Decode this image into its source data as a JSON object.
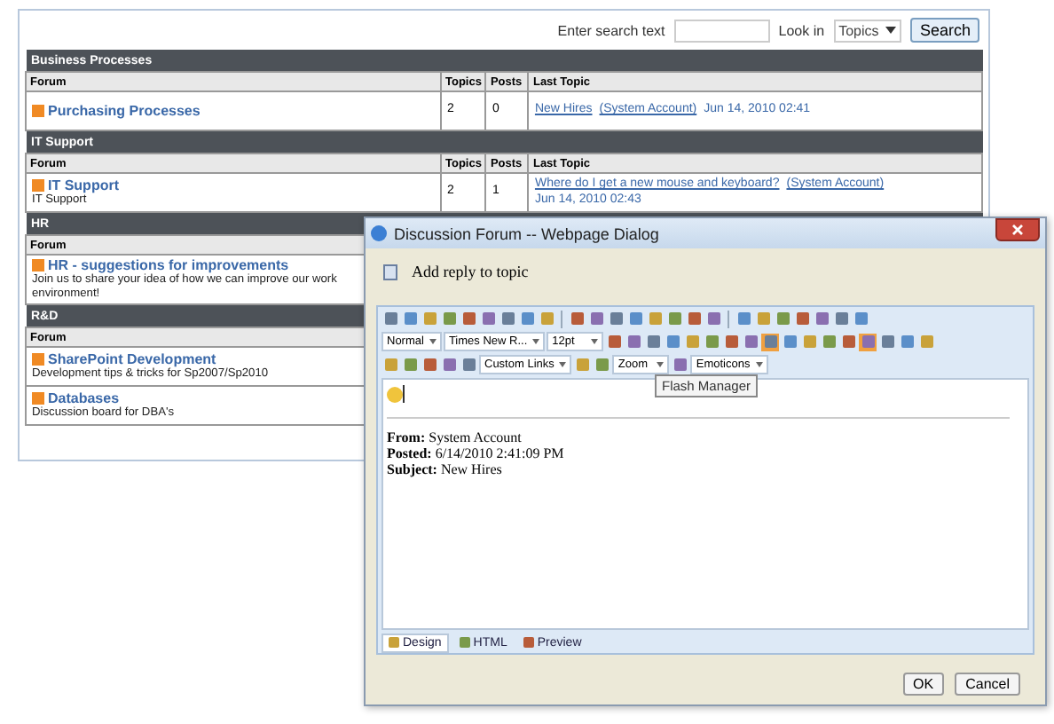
{
  "search": {
    "label": "Enter search text",
    "look_in_label": "Look in",
    "look_in_value": "Topics",
    "button": "Search"
  },
  "sections": [
    {
      "title": "Business Processes",
      "columns": [
        "Forum",
        "Topics",
        "Posts",
        "Last Topic"
      ],
      "rows": [
        {
          "name": "Purchasing Processes",
          "topics": "2",
          "posts": "0",
          "last_topic": "New Hires",
          "author": "(System Account)",
          "date": "Jun 14, 2010 02:41"
        }
      ]
    },
    {
      "title": "IT Support",
      "columns": [
        "Forum",
        "Topics",
        "Posts",
        "Last Topic"
      ],
      "rows": [
        {
          "name": "IT Support",
          "description_lines": [
            "IT Support"
          ],
          "topics": "2",
          "posts": "1",
          "last_topic": "Where do I get a new mouse and keyboard?",
          "author": "(System Account)",
          "date": "Jun 14, 2010 02:43"
        }
      ]
    },
    {
      "title": "HR",
      "columns": [
        "Forum"
      ],
      "rows": [
        {
          "name": "HR - suggestions for improvements",
          "description_lines": [
            "Join us to share your idea of how we can improve our work",
            "environment!"
          ]
        }
      ]
    },
    {
      "title": "R&D",
      "columns": [
        "Forum"
      ],
      "rows": [
        {
          "name": "SharePoint Development",
          "description_lines": [
            "Development tips & tricks for Sp2007/Sp2010"
          ]
        },
        {
          "name": "Databases",
          "description_lines": [
            "Discussion board for DBA's"
          ]
        }
      ]
    }
  ],
  "dialog": {
    "title": "Discussion Forum -- Webpage Dialog",
    "heading": "Add reply to topic",
    "toolbar_rows": [
      [
        {
          "kind": "icon"
        },
        {
          "kind": "icon"
        },
        {
          "kind": "icon"
        },
        {
          "kind": "icon"
        },
        {
          "kind": "icon"
        },
        {
          "kind": "icon"
        },
        {
          "kind": "icon"
        },
        {
          "kind": "icon"
        },
        {
          "kind": "icon"
        },
        {
          "kind": "sep"
        },
        {
          "kind": "icon"
        },
        {
          "kind": "icon"
        },
        {
          "kind": "icon"
        },
        {
          "kind": "icon"
        },
        {
          "kind": "icon"
        },
        {
          "kind": "icon"
        },
        {
          "kind": "icon"
        },
        {
          "kind": "icon"
        },
        {
          "kind": "sep"
        },
        {
          "kind": "icon"
        },
        {
          "kind": "icon"
        },
        {
          "kind": "icon"
        },
        {
          "kind": "icon"
        },
        {
          "kind": "icon"
        },
        {
          "kind": "icon"
        },
        {
          "kind": "icon"
        }
      ],
      [
        {
          "kind": "select",
          "label": "Normal"
        },
        {
          "kind": "select",
          "label": "Times New R..."
        },
        {
          "kind": "select",
          "label": "12pt"
        },
        {
          "kind": "icon"
        },
        {
          "kind": "icon"
        },
        {
          "kind": "icon"
        },
        {
          "kind": "icon"
        },
        {
          "kind": "icon"
        },
        {
          "kind": "icon"
        },
        {
          "kind": "icon"
        },
        {
          "kind": "icon"
        },
        {
          "kind": "icon",
          "on": true
        },
        {
          "kind": "icon"
        },
        {
          "kind": "icon"
        },
        {
          "kind": "icon"
        },
        {
          "kind": "icon"
        },
        {
          "kind": "icon",
          "on": true
        },
        {
          "kind": "icon"
        },
        {
          "kind": "icon"
        },
        {
          "kind": "icon"
        }
      ],
      [
        {
          "kind": "icon"
        },
        {
          "kind": "icon"
        },
        {
          "kind": "icon"
        },
        {
          "kind": "icon"
        },
        {
          "kind": "icon"
        },
        {
          "kind": "select",
          "label": "Custom Links"
        },
        {
          "kind": "icon"
        },
        {
          "kind": "icon"
        },
        {
          "kind": "select",
          "label": "Zoom"
        },
        {
          "kind": "icon"
        },
        {
          "kind": "select",
          "label": "Emoticons"
        }
      ]
    ],
    "tooltip": "Flash Manager",
    "body_lines": [
      "**From:** System Account",
      "**Posted:** 6/14/2010 2:41:09 PM",
      "**Subject:** New Hires"
    ],
    "tabs": [
      {
        "label": "Design",
        "selected": true
      },
      {
        "label": "HTML",
        "selected": false
      },
      {
        "label": "Preview",
        "selected": false
      }
    ],
    "buttons": [
      "OK",
      "Cancel"
    ]
  }
}
